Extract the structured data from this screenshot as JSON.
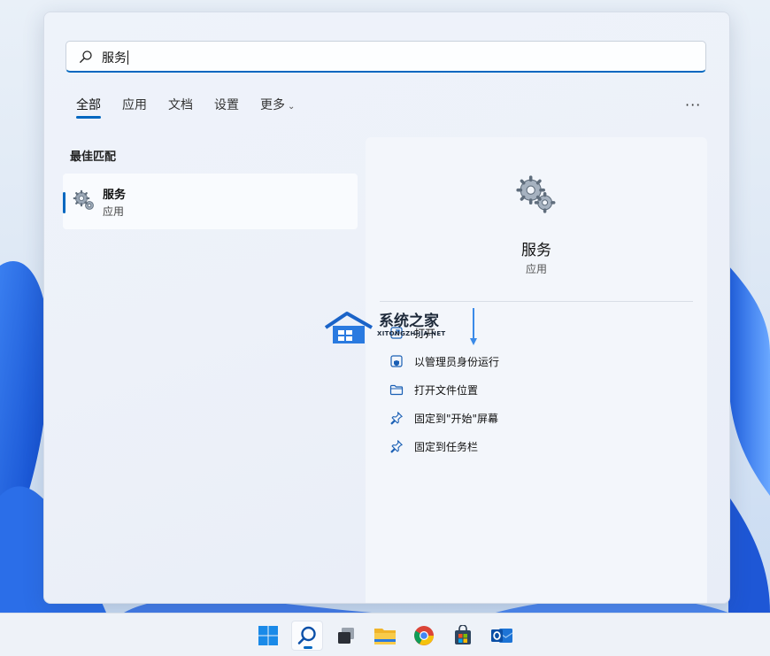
{
  "search": {
    "query": "服务"
  },
  "tabs": [
    {
      "label": "全部",
      "active": true
    },
    {
      "label": "应用"
    },
    {
      "label": "文档"
    },
    {
      "label": "设置"
    },
    {
      "label": "更多"
    }
  ],
  "more_options": "···",
  "best_match": {
    "title": "最佳匹配",
    "name": "服务",
    "type": "应用",
    "icon": "gear-icon"
  },
  "detail": {
    "name": "服务",
    "type": "应用",
    "actions": [
      {
        "label": "打开",
        "icon": "open-icon"
      },
      {
        "label": "以管理员身份运行",
        "icon": "shield-icon"
      },
      {
        "label": "打开文件位置",
        "icon": "folder-icon"
      },
      {
        "label": "固定到\"开始\"屏幕",
        "icon": "pin-icon"
      },
      {
        "label": "固定到任务栏",
        "icon": "pin-icon"
      }
    ]
  },
  "watermark": {
    "title": "系统之家",
    "subtitle": "XITONGZHIJIA.NET"
  },
  "taskbar": {
    "items": [
      "start-icon",
      "search-icon",
      "task-view-icon",
      "file-explorer-icon",
      "chrome-icon",
      "store-icon",
      "outlook-icon"
    ],
    "active": "search-icon"
  },
  "colors": {
    "accent": "#0067c0"
  }
}
